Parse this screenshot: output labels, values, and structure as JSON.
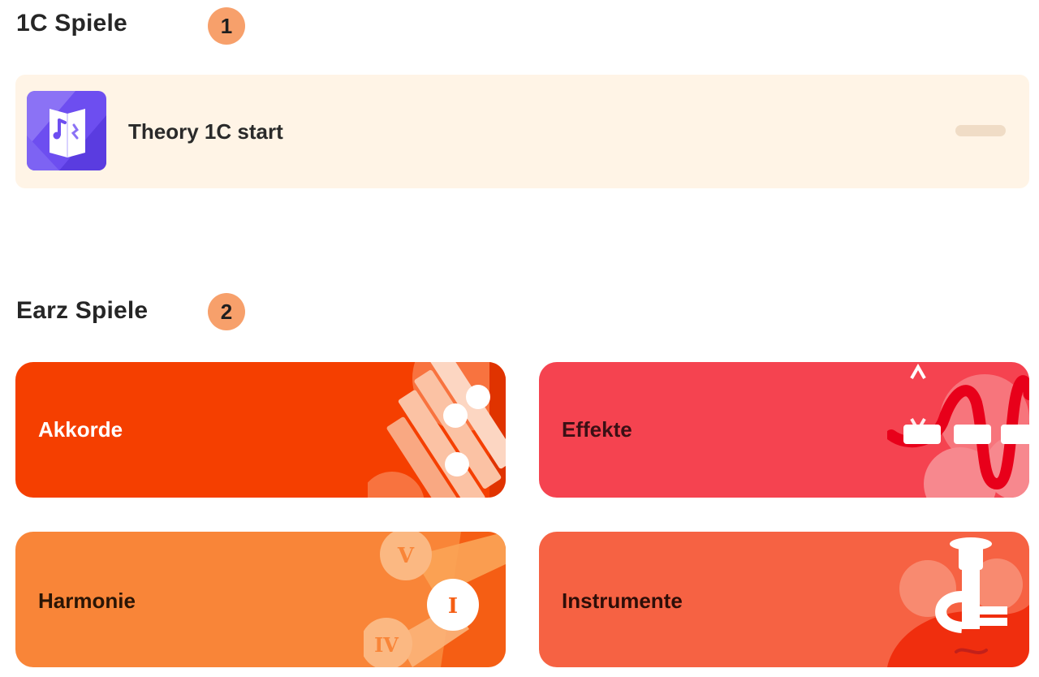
{
  "sections": {
    "first": {
      "title": "1C Spiele",
      "badge": "1"
    },
    "second": {
      "title": "Earz Spiele",
      "badge": "2"
    }
  },
  "theory_item": {
    "label": "Theory 1C start",
    "icon": "music-book-icon",
    "progress_percent": 0
  },
  "cards": {
    "akkorde": {
      "label": "Akkorde",
      "color": "#F53F00",
      "icon": "piano-keys-icon"
    },
    "effekte": {
      "label": "Effekte",
      "color": "#F54350",
      "icon": "waveform-icon"
    },
    "harmonie": {
      "label": "Harmonie",
      "color": "#F98538",
      "icon": "chord-degrees-icon",
      "degrees": [
        "V",
        "I",
        "IV"
      ]
    },
    "instrumente": {
      "label": "Instrumente",
      "color": "#F66243",
      "icon": "tuba-icon"
    }
  }
}
